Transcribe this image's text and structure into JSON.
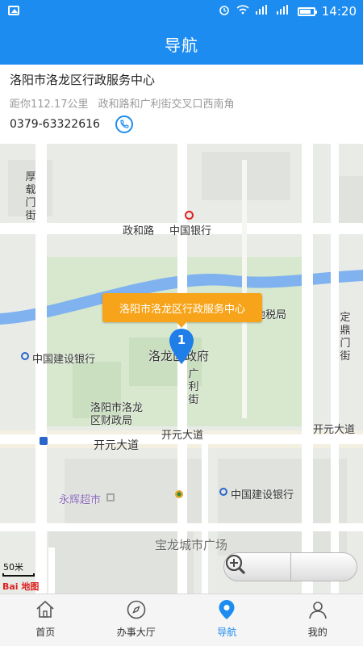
{
  "status_bar": {
    "time": "14:20",
    "battery_level": 0.8
  },
  "header": {
    "title": "导航"
  },
  "location": {
    "name": "洛阳市洛龙区行政服务中心",
    "distance": "距你112.17公里",
    "address": "政和路和广利街交叉口西南角",
    "phone": "0379-63322616"
  },
  "map": {
    "colors": {
      "road": "#ffffff",
      "green": "#d7e8cf",
      "water": "#7fb2ee",
      "block": "#dfe2dd",
      "marker": "#1f7ee8",
      "tooltip": "#f7a41a",
      "accent": "#1d8cf0"
    },
    "popup_label": "洛阳市洛龙区行政服务中心",
    "marker_number": "1",
    "labels": {
      "houzai": "厚载门街",
      "zhenghe": "政和路",
      "bank_china": "中国银行",
      "dishui": "地税局",
      "dingding": "定鼎门街",
      "ccb_left": "中国建设银行",
      "luolong_gov": "洛龙区政府",
      "guangli": "广利街",
      "finance": "洛阳市洛龙区财政局",
      "kaiyuan_left": "开元大道",
      "kaiyuan_mid": "开元大道",
      "kaiyuan_right": "开元大道",
      "yonghui": "永辉超市",
      "ccb_right": "中国建设银行",
      "baolong": "宝龙城市广场"
    },
    "scale": "50米",
    "logo_text": "Bai 地图"
  },
  "tabs": [
    {
      "label": "首页",
      "icon": "home-icon",
      "active": false
    },
    {
      "label": "办事大厅",
      "icon": "compass-icon",
      "active": false
    },
    {
      "label": "导航",
      "icon": "location-pin-icon",
      "active": true
    },
    {
      "label": "我的",
      "icon": "user-icon",
      "active": false
    }
  ]
}
